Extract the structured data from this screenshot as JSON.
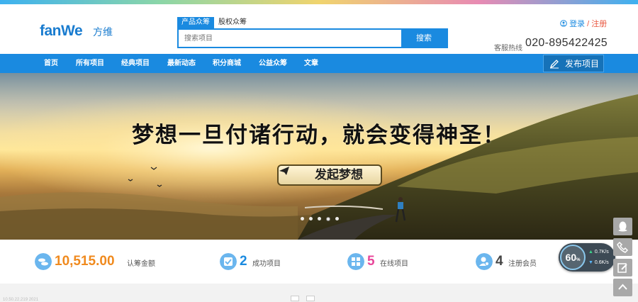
{
  "header": {
    "logo_text": "fanWe",
    "logo_sub": "方维",
    "search_tabs": [
      "产品众筹",
      "股权众筹"
    ],
    "search_placeholder": "搜索项目",
    "search_button": "搜索",
    "login": "登录",
    "separator": "/",
    "register": "注册",
    "hotline_label": "客服热线",
    "hotline": "020-895422425"
  },
  "nav": {
    "items": [
      "首页",
      "所有项目",
      "经典项目",
      "最新动态",
      "积分商城",
      "公益众筹",
      "文章"
    ],
    "publish": "发布项目"
  },
  "banner": {
    "slogan": "梦想一旦付诸行动，就会变得神圣！",
    "cta": "发起梦想",
    "slide_count": 5,
    "active_slide": 4
  },
  "stats": [
    {
      "value": "10,515.00",
      "label": "认筹金额",
      "color": "#f08a1e",
      "icon": "coins-icon"
    },
    {
      "value": "2",
      "label": "成功项目",
      "color": "#1a8ae0",
      "icon": "success-icon"
    },
    {
      "value": "5",
      "label": "在线项目",
      "color": "#e8479a",
      "icon": "grid-icon"
    },
    {
      "value": "4",
      "label": "注册会员",
      "color": "#444444",
      "icon": "member-icon"
    }
  ],
  "speed_widget": {
    "percent": "60",
    "percent_unit": "%",
    "upload": "0.7",
    "download": "0.6",
    "unit": "K/s"
  },
  "bottom_text": "10.50.22.219 2021"
}
